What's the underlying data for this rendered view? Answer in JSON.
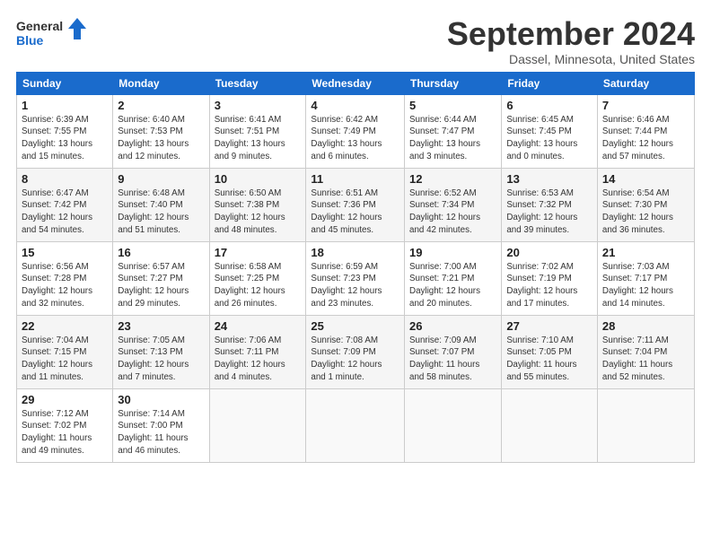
{
  "header": {
    "logo_line1": "General",
    "logo_line2": "Blue",
    "month": "September 2024",
    "location": "Dassel, Minnesota, United States"
  },
  "days_of_week": [
    "Sunday",
    "Monday",
    "Tuesday",
    "Wednesday",
    "Thursday",
    "Friday",
    "Saturday"
  ],
  "weeks": [
    [
      {
        "num": "1",
        "info": "Sunrise: 6:39 AM\nSunset: 7:55 PM\nDaylight: 13 hours\nand 15 minutes."
      },
      {
        "num": "2",
        "info": "Sunrise: 6:40 AM\nSunset: 7:53 PM\nDaylight: 13 hours\nand 12 minutes."
      },
      {
        "num": "3",
        "info": "Sunrise: 6:41 AM\nSunset: 7:51 PM\nDaylight: 13 hours\nand 9 minutes."
      },
      {
        "num": "4",
        "info": "Sunrise: 6:42 AM\nSunset: 7:49 PM\nDaylight: 13 hours\nand 6 minutes."
      },
      {
        "num": "5",
        "info": "Sunrise: 6:44 AM\nSunset: 7:47 PM\nDaylight: 13 hours\nand 3 minutes."
      },
      {
        "num": "6",
        "info": "Sunrise: 6:45 AM\nSunset: 7:45 PM\nDaylight: 13 hours\nand 0 minutes."
      },
      {
        "num": "7",
        "info": "Sunrise: 6:46 AM\nSunset: 7:44 PM\nDaylight: 12 hours\nand 57 minutes."
      }
    ],
    [
      {
        "num": "8",
        "info": "Sunrise: 6:47 AM\nSunset: 7:42 PM\nDaylight: 12 hours\nand 54 minutes."
      },
      {
        "num": "9",
        "info": "Sunrise: 6:48 AM\nSunset: 7:40 PM\nDaylight: 12 hours\nand 51 minutes."
      },
      {
        "num": "10",
        "info": "Sunrise: 6:50 AM\nSunset: 7:38 PM\nDaylight: 12 hours\nand 48 minutes."
      },
      {
        "num": "11",
        "info": "Sunrise: 6:51 AM\nSunset: 7:36 PM\nDaylight: 12 hours\nand 45 minutes."
      },
      {
        "num": "12",
        "info": "Sunrise: 6:52 AM\nSunset: 7:34 PM\nDaylight: 12 hours\nand 42 minutes."
      },
      {
        "num": "13",
        "info": "Sunrise: 6:53 AM\nSunset: 7:32 PM\nDaylight: 12 hours\nand 39 minutes."
      },
      {
        "num": "14",
        "info": "Sunrise: 6:54 AM\nSunset: 7:30 PM\nDaylight: 12 hours\nand 36 minutes."
      }
    ],
    [
      {
        "num": "15",
        "info": "Sunrise: 6:56 AM\nSunset: 7:28 PM\nDaylight: 12 hours\nand 32 minutes."
      },
      {
        "num": "16",
        "info": "Sunrise: 6:57 AM\nSunset: 7:27 PM\nDaylight: 12 hours\nand 29 minutes."
      },
      {
        "num": "17",
        "info": "Sunrise: 6:58 AM\nSunset: 7:25 PM\nDaylight: 12 hours\nand 26 minutes."
      },
      {
        "num": "18",
        "info": "Sunrise: 6:59 AM\nSunset: 7:23 PM\nDaylight: 12 hours\nand 23 minutes."
      },
      {
        "num": "19",
        "info": "Sunrise: 7:00 AM\nSunset: 7:21 PM\nDaylight: 12 hours\nand 20 minutes."
      },
      {
        "num": "20",
        "info": "Sunrise: 7:02 AM\nSunset: 7:19 PM\nDaylight: 12 hours\nand 17 minutes."
      },
      {
        "num": "21",
        "info": "Sunrise: 7:03 AM\nSunset: 7:17 PM\nDaylight: 12 hours\nand 14 minutes."
      }
    ],
    [
      {
        "num": "22",
        "info": "Sunrise: 7:04 AM\nSunset: 7:15 PM\nDaylight: 12 hours\nand 11 minutes."
      },
      {
        "num": "23",
        "info": "Sunrise: 7:05 AM\nSunset: 7:13 PM\nDaylight: 12 hours\nand 7 minutes."
      },
      {
        "num": "24",
        "info": "Sunrise: 7:06 AM\nSunset: 7:11 PM\nDaylight: 12 hours\nand 4 minutes."
      },
      {
        "num": "25",
        "info": "Sunrise: 7:08 AM\nSunset: 7:09 PM\nDaylight: 12 hours\nand 1 minute."
      },
      {
        "num": "26",
        "info": "Sunrise: 7:09 AM\nSunset: 7:07 PM\nDaylight: 11 hours\nand 58 minutes."
      },
      {
        "num": "27",
        "info": "Sunrise: 7:10 AM\nSunset: 7:05 PM\nDaylight: 11 hours\nand 55 minutes."
      },
      {
        "num": "28",
        "info": "Sunrise: 7:11 AM\nSunset: 7:04 PM\nDaylight: 11 hours\nand 52 minutes."
      }
    ],
    [
      {
        "num": "29",
        "info": "Sunrise: 7:12 AM\nSunset: 7:02 PM\nDaylight: 11 hours\nand 49 minutes."
      },
      {
        "num": "30",
        "info": "Sunrise: 7:14 AM\nSunset: 7:00 PM\nDaylight: 11 hours\nand 46 minutes."
      },
      {
        "num": "",
        "info": ""
      },
      {
        "num": "",
        "info": ""
      },
      {
        "num": "",
        "info": ""
      },
      {
        "num": "",
        "info": ""
      },
      {
        "num": "",
        "info": ""
      }
    ]
  ]
}
